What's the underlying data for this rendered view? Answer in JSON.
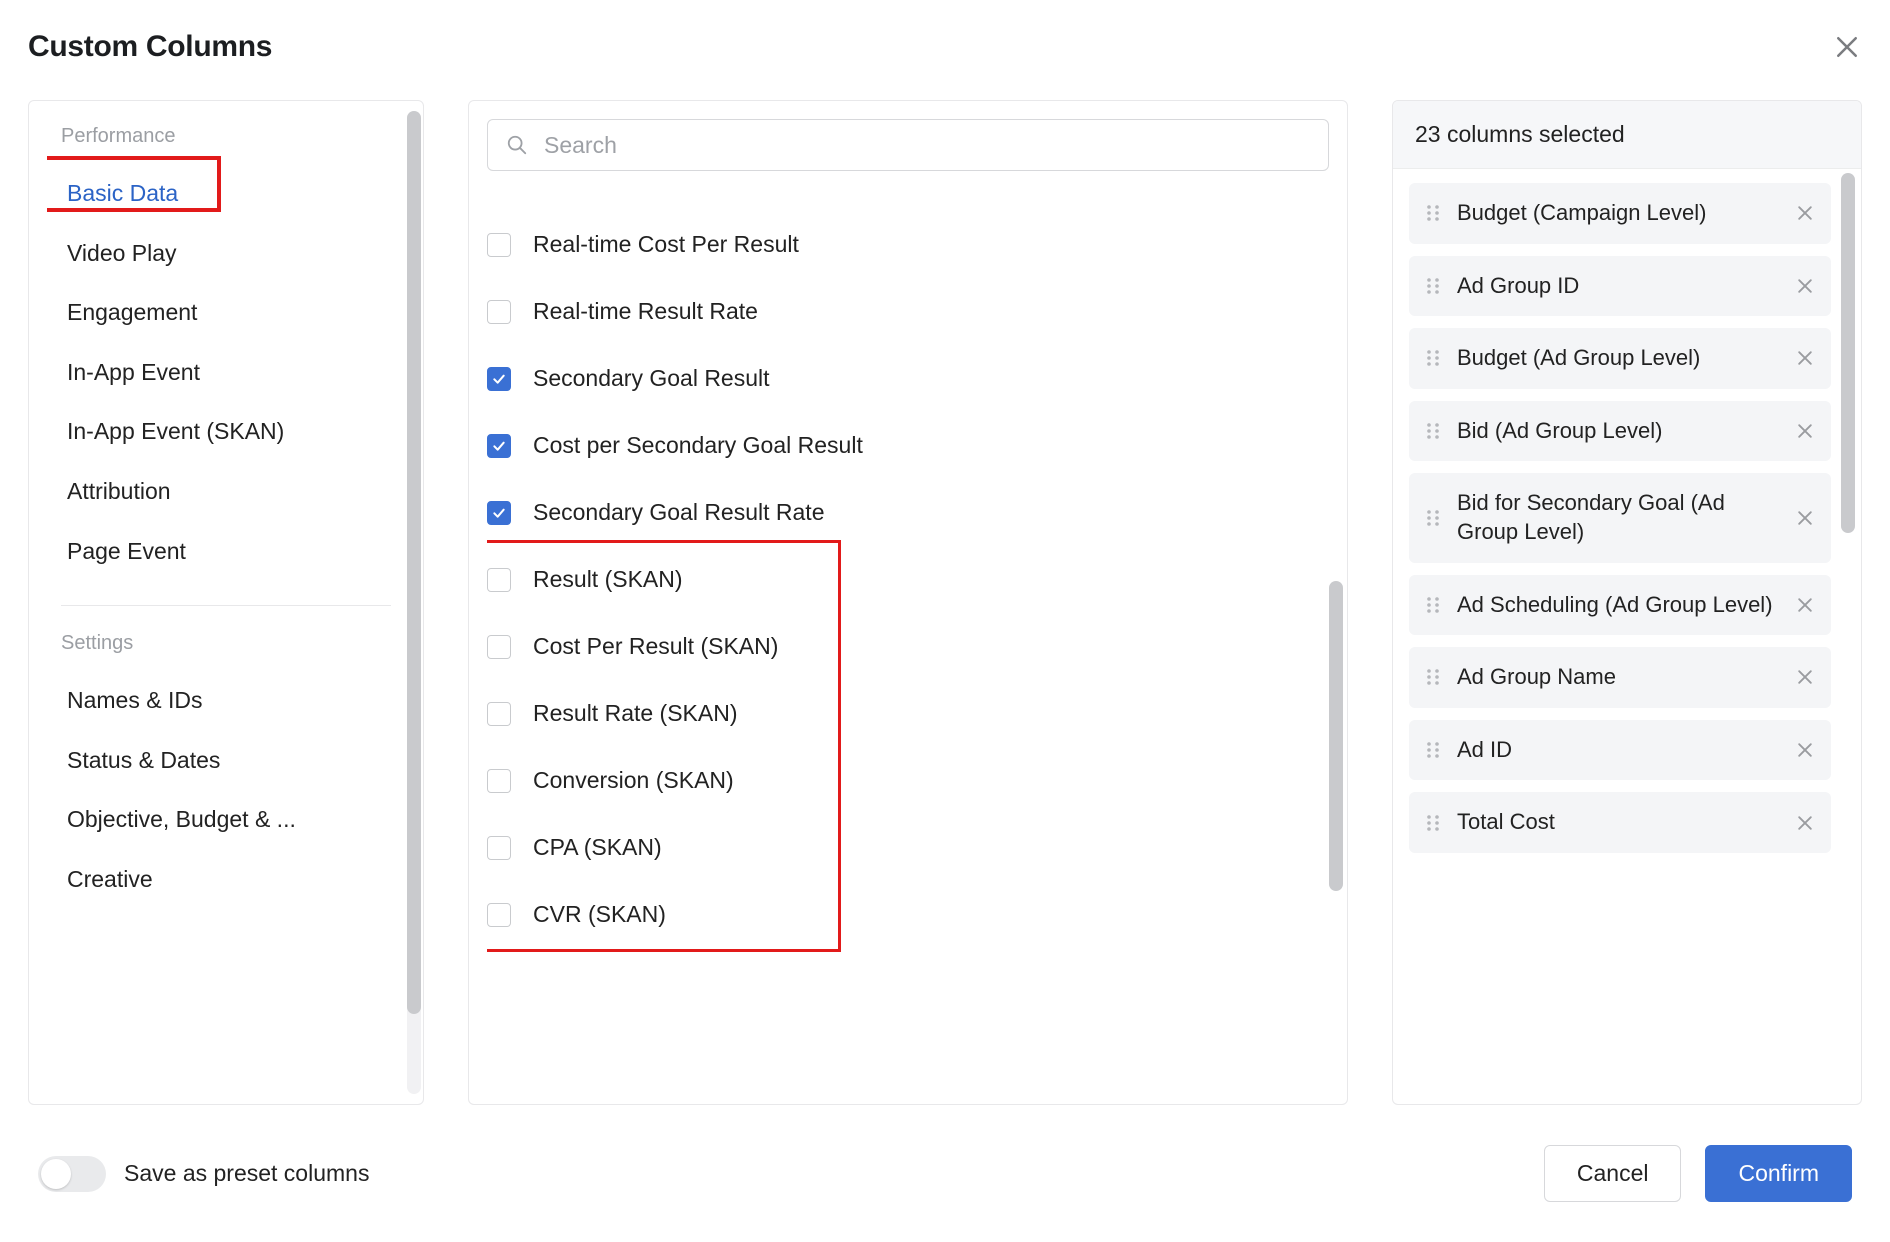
{
  "header": {
    "title": "Custom Columns"
  },
  "sidebar": {
    "sections": [
      {
        "title": "Performance",
        "items": [
          {
            "label": "Basic Data",
            "active": true
          },
          {
            "label": "Video Play",
            "active": false
          },
          {
            "label": "Engagement",
            "active": false
          },
          {
            "label": "In-App Event",
            "active": false
          },
          {
            "label": "In-App Event (SKAN)",
            "active": false
          },
          {
            "label": "Attribution",
            "active": false
          },
          {
            "label": "Page Event",
            "active": false
          }
        ]
      },
      {
        "title": "Settings",
        "items": [
          {
            "label": "Names & IDs",
            "active": false
          },
          {
            "label": "Status & Dates",
            "active": false
          },
          {
            "label": "Objective, Budget & ...",
            "active": false
          },
          {
            "label": "Creative",
            "active": false
          }
        ]
      }
    ]
  },
  "search": {
    "placeholder": "Search"
  },
  "options": [
    {
      "label": "Real-time Cost Per Result",
      "checked": false
    },
    {
      "label": "Real-time Result Rate",
      "checked": false
    },
    {
      "label": "Secondary Goal Result",
      "checked": true
    },
    {
      "label": "Cost per Secondary Goal Result",
      "checked": true
    },
    {
      "label": "Secondary Goal Result Rate",
      "checked": true
    },
    {
      "label": "Result (SKAN)",
      "checked": false
    },
    {
      "label": "Cost Per Result (SKAN)",
      "checked": false
    },
    {
      "label": "Result Rate (SKAN)",
      "checked": false
    },
    {
      "label": "Conversion (SKAN)",
      "checked": false
    },
    {
      "label": "CPA (SKAN)",
      "checked": false
    },
    {
      "label": "CVR (SKAN)",
      "checked": false
    }
  ],
  "selected": {
    "header": "23 columns selected",
    "items": [
      "Budget (Campaign Level)",
      "Ad Group ID",
      "Budget (Ad Group Level)",
      "Bid (Ad Group Level)",
      "Bid for Secondary Goal (Ad Group Level)",
      "Ad Scheduling (Ad Group Level)",
      "Ad Group Name",
      "Ad ID",
      "Total Cost"
    ]
  },
  "footer": {
    "toggle_label": "Save as preset columns",
    "cancel": "Cancel",
    "confirm": "Confirm"
  }
}
